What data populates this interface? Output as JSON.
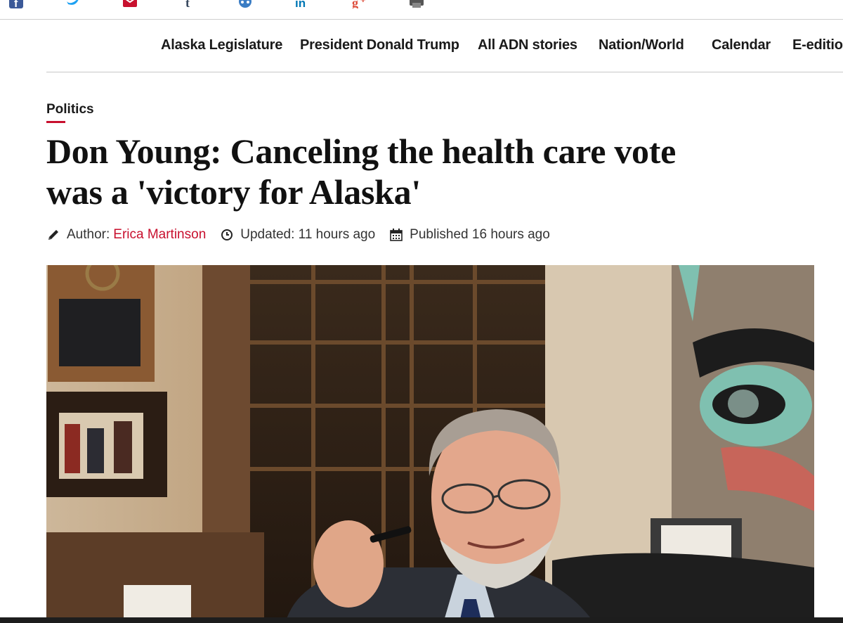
{
  "share": {
    "icons": [
      "facebook-icon",
      "twitter-icon",
      "email-icon",
      "tumblr-icon",
      "reddit-icon",
      "linkedin-icon",
      "google-plus-icon",
      "print-icon"
    ]
  },
  "nav": {
    "items": [
      "Alaska Legislature",
      "President Donald Trump",
      "All ADN stories",
      "Nation/World",
      "Calendar",
      "E-edition"
    ]
  },
  "article": {
    "section": "Politics",
    "headline_line1": "Don Young: Canceling the health care vote",
    "headline_line2": "was a 'victory for Alaska'",
    "author_label": "Author:",
    "author_name": "Erica Martinson",
    "updated": "Updated: 11 hours ago",
    "published": "Published 16 hours ago"
  },
  "colors": {
    "accent": "#c8102e",
    "facebook": "#3b5998",
    "twitter": "#1da1f2",
    "email": "#c8102e",
    "tumblr": "#35465c",
    "reddit": "#3b7dc4",
    "linkedin": "#0077b5",
    "google_plus": "#dd4b39",
    "print": "#555555"
  }
}
